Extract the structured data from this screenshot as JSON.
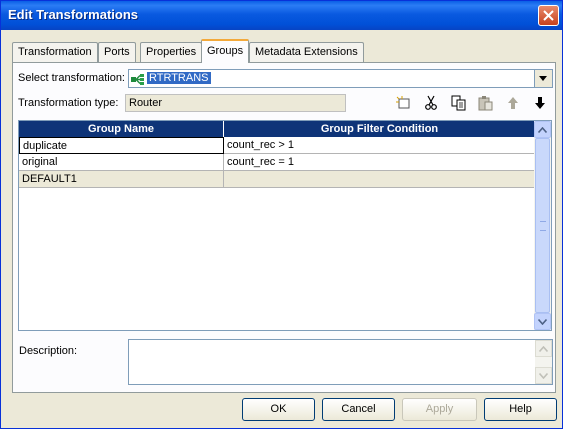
{
  "window": {
    "title": "Edit Transformations"
  },
  "tabs": [
    {
      "label": "Transformation",
      "active": false
    },
    {
      "label": "Ports",
      "active": false
    },
    {
      "label": "Properties",
      "active": false
    },
    {
      "label": "Groups",
      "active": true
    },
    {
      "label": "Metadata Extensions",
      "active": false
    }
  ],
  "select_transformation": {
    "label": "Select transformation:",
    "value": "RTRTRANS",
    "icon": "router-icon"
  },
  "transformation_type": {
    "label": "Transformation type:",
    "value": "Router"
  },
  "toolbar": [
    "new-icon",
    "cut-icon",
    "copy-icon",
    "paste-icon",
    "move-up-icon",
    "move-down-icon"
  ],
  "grid": {
    "columns": [
      "Group Name",
      "Group Filter Condition"
    ],
    "rows": [
      {
        "name": "duplicate",
        "condition": "count_rec > 1"
      },
      {
        "name": "original",
        "condition": "count_rec = 1"
      },
      {
        "name": "DEFAULT1",
        "condition": ""
      }
    ]
  },
  "description": {
    "label": "Description:",
    "value": ""
  },
  "buttons": {
    "ok": "OK",
    "cancel": "Cancel",
    "apply": "Apply",
    "help": "Help"
  },
  "colors": {
    "title_bar": "#0054e3",
    "grid_header": "#0e3478",
    "selection": "#316ac5",
    "active_tab_accent": "#f3a93b"
  }
}
